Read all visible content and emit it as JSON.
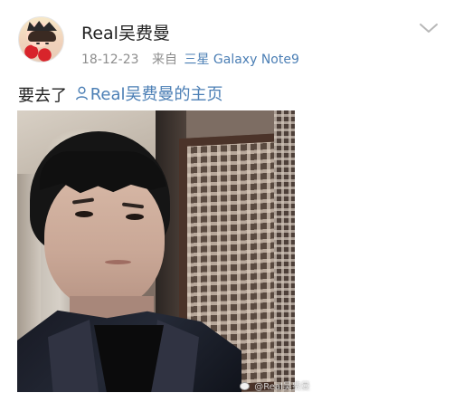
{
  "post": {
    "author": "Real吴费曼",
    "date": "18-12-23",
    "source_prefix": "来自",
    "device": "三星 Galaxy Note9",
    "text": "要去了",
    "mention": "Real吴费曼的主页",
    "watermark": "@Real吴费曼"
  },
  "icons": {
    "avatar": "avatar-photo",
    "menu": "chevron-down-icon",
    "mention": "person-icon",
    "watermark": "weibo-icon"
  },
  "colors": {
    "link": "#4c7fb5",
    "meta": "#8d8d8d",
    "text": "#222222"
  }
}
